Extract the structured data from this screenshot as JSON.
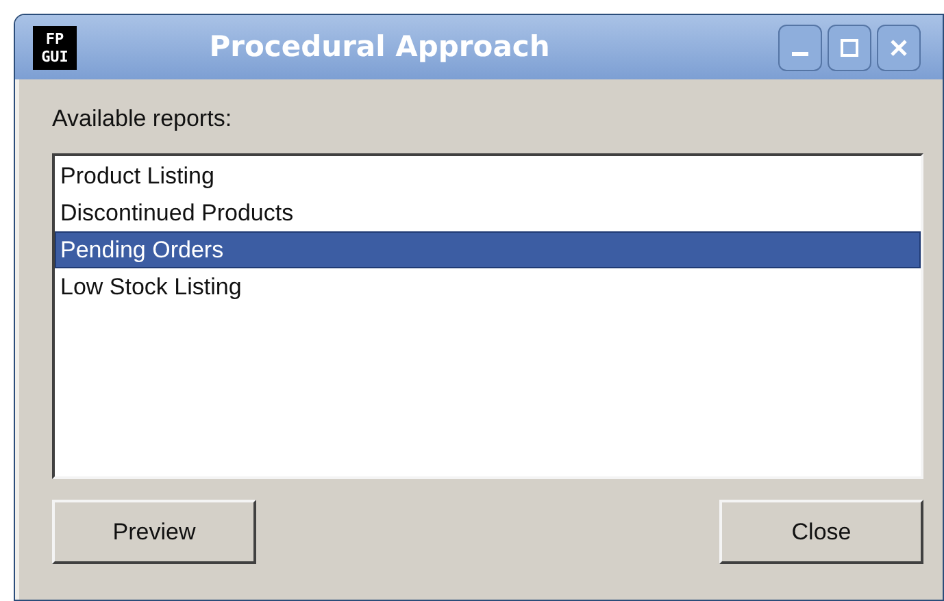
{
  "window": {
    "title": "Procedural Approach",
    "logo": [
      "FP",
      "GUI"
    ]
  },
  "label": "Available reports:",
  "reports": [
    {
      "label": "Product Listing",
      "selected": false
    },
    {
      "label": "Discontinued Products",
      "selected": false
    },
    {
      "label": "Pending Orders",
      "selected": true
    },
    {
      "label": "Low Stock Listing",
      "selected": false
    }
  ],
  "buttons": [
    "Preview",
    "Close"
  ]
}
